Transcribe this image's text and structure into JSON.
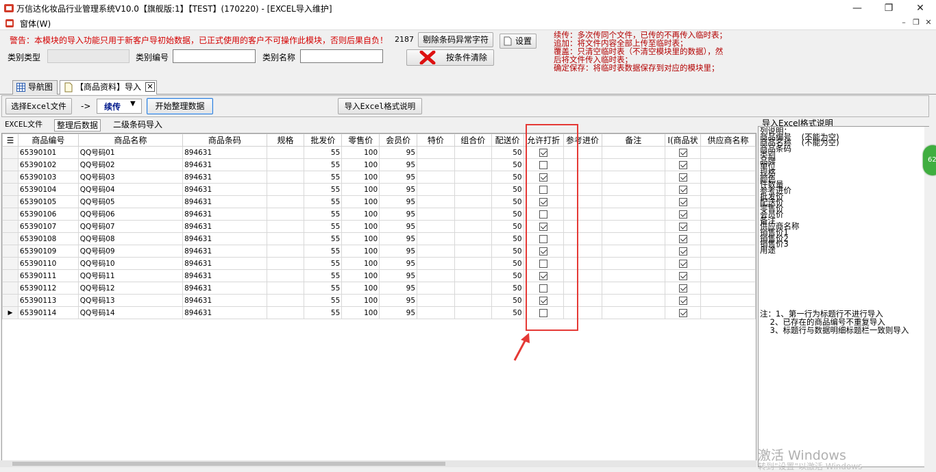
{
  "window": {
    "title": "万信达化妆品行业管理系统V10.0【旗舰版:1】【TEST】(170220) - [EXCEL导入维护]",
    "minimize": "—",
    "restore": "❐",
    "close": "✕"
  },
  "menubar": {
    "window_menu": "窗体(W)",
    "mdi_min": "–",
    "mdi_restore": "❐",
    "mdi_close": "✕"
  },
  "header": {
    "warning": "警告：本模块的导入功能只用于新客户导初始数据，已正式使用的客户不可操作此模块，否则后果自负！",
    "count": "2187",
    "remove_button": "剔除条码异常字符",
    "clear_button": "按条件清除",
    "settings_button": "设置",
    "category_type_label": "类别类型",
    "category_type_value": "",
    "category_code_label": "类别编号",
    "category_code_value": "",
    "category_name_label": "类别名称",
    "category_name_value": "",
    "notes": [
      "续传：多次传同个文件，已传的不再传入临时表；",
      "追加：将文件内容全部上传至临时表；",
      "覆盖：只清空临时表（不清空模块里的数据），然",
      "后将文件传入临时表；",
      "确定保存：将临时表数据保存到对应的模块里；"
    ]
  },
  "tabs": {
    "nav": "导航图",
    "import": "【商品资料】导入"
  },
  "toolbar": {
    "select_excel": "选择Excel文件",
    "arrow": "->",
    "mode": "续传",
    "start": "开始整理数据",
    "format_help": "导入Excel格式说明"
  },
  "subtabs": {
    "excel": "EXCEL文件",
    "sorted": "整理后数据",
    "barcode": "二级条码导入"
  },
  "grid": {
    "columns": [
      "商品编号",
      "商品名称",
      "商品条码",
      "规格",
      "批发价",
      "零售价",
      "会员价",
      "特价",
      "组合价",
      "配送价",
      "允许打折",
      "参考进价",
      "备注",
      "I(商品状",
      "供应商名称"
    ],
    "rows": [
      {
        "code": "65390101",
        "name": "QQ号码01",
        "barcode": "894631",
        "spec": "",
        "wholesale": "55",
        "retail": "100",
        "member": "95",
        "special": "",
        "combo": "",
        "delivery": "50",
        "discount": true,
        "ref": "",
        "remark": "",
        "status": true,
        "supplier": "",
        "current": false
      },
      {
        "code": "65390102",
        "name": "QQ号码02",
        "barcode": "894631",
        "spec": "",
        "wholesale": "55",
        "retail": "100",
        "member": "95",
        "special": "",
        "combo": "",
        "delivery": "50",
        "discount": false,
        "ref": "",
        "remark": "",
        "status": true,
        "supplier": "",
        "current": false
      },
      {
        "code": "65390103",
        "name": "QQ号码03",
        "barcode": "894631",
        "spec": "",
        "wholesale": "55",
        "retail": "100",
        "member": "95",
        "special": "",
        "combo": "",
        "delivery": "50",
        "discount": true,
        "ref": "",
        "remark": "",
        "status": true,
        "supplier": "",
        "current": false
      },
      {
        "code": "65390104",
        "name": "QQ号码04",
        "barcode": "894631",
        "spec": "",
        "wholesale": "55",
        "retail": "100",
        "member": "95",
        "special": "",
        "combo": "",
        "delivery": "50",
        "discount": false,
        "ref": "",
        "remark": "",
        "status": true,
        "supplier": "",
        "current": false
      },
      {
        "code": "65390105",
        "name": "QQ号码05",
        "barcode": "894631",
        "spec": "",
        "wholesale": "55",
        "retail": "100",
        "member": "95",
        "special": "",
        "combo": "",
        "delivery": "50",
        "discount": true,
        "ref": "",
        "remark": "",
        "status": true,
        "supplier": "",
        "current": false
      },
      {
        "code": "65390106",
        "name": "QQ号码06",
        "barcode": "894631",
        "spec": "",
        "wholesale": "55",
        "retail": "100",
        "member": "95",
        "special": "",
        "combo": "",
        "delivery": "50",
        "discount": false,
        "ref": "",
        "remark": "",
        "status": true,
        "supplier": "",
        "current": false
      },
      {
        "code": "65390107",
        "name": "QQ号码07",
        "barcode": "894631",
        "spec": "",
        "wholesale": "55",
        "retail": "100",
        "member": "95",
        "special": "",
        "combo": "",
        "delivery": "50",
        "discount": true,
        "ref": "",
        "remark": "",
        "status": true,
        "supplier": "",
        "current": false
      },
      {
        "code": "65390108",
        "name": "QQ号码08",
        "barcode": "894631",
        "spec": "",
        "wholesale": "55",
        "retail": "100",
        "member": "95",
        "special": "",
        "combo": "",
        "delivery": "50",
        "discount": false,
        "ref": "",
        "remark": "",
        "status": true,
        "supplier": "",
        "current": false
      },
      {
        "code": "65390109",
        "name": "QQ号码09",
        "barcode": "894631",
        "spec": "",
        "wholesale": "55",
        "retail": "100",
        "member": "95",
        "special": "",
        "combo": "",
        "delivery": "50",
        "discount": true,
        "ref": "",
        "remark": "",
        "status": true,
        "supplier": "",
        "current": false
      },
      {
        "code": "65390110",
        "name": "QQ号码10",
        "barcode": "894631",
        "spec": "",
        "wholesale": "55",
        "retail": "100",
        "member": "95",
        "special": "",
        "combo": "",
        "delivery": "50",
        "discount": false,
        "ref": "",
        "remark": "",
        "status": true,
        "supplier": "",
        "current": false
      },
      {
        "code": "65390111",
        "name": "QQ号码11",
        "barcode": "894631",
        "spec": "",
        "wholesale": "55",
        "retail": "100",
        "member": "95",
        "special": "",
        "combo": "",
        "delivery": "50",
        "discount": true,
        "ref": "",
        "remark": "",
        "status": true,
        "supplier": "",
        "current": false
      },
      {
        "code": "65390112",
        "name": "QQ号码12",
        "barcode": "894631",
        "spec": "",
        "wholesale": "55",
        "retail": "100",
        "member": "95",
        "special": "",
        "combo": "",
        "delivery": "50",
        "discount": false,
        "ref": "",
        "remark": "",
        "status": true,
        "supplier": "",
        "current": false
      },
      {
        "code": "65390113",
        "name": "QQ号码13",
        "barcode": "894631",
        "spec": "",
        "wholesale": "55",
        "retail": "100",
        "member": "95",
        "special": "",
        "combo": "",
        "delivery": "50",
        "discount": true,
        "ref": "",
        "remark": "",
        "status": true,
        "supplier": "",
        "current": false
      },
      {
        "code": "65390114",
        "name": "QQ号码14",
        "barcode": "894631",
        "spec": "",
        "wholesale": "55",
        "retail": "100",
        "member": "95",
        "special": "",
        "combo": "",
        "delivery": "50",
        "discount": false,
        "ref": "",
        "remark": "",
        "status": true,
        "supplier": "",
        "current": true
      }
    ]
  },
  "right_panel": {
    "title": "导入Excel格式说明",
    "lines": [
      "列说明：",
      "商品编号    (不能为空)",
      "商品名称    (不能为空)",
      "商品条码",
      "类别",
      "品牌",
      "单位",
      "规格",
      "颜色",
      "件数量",
      "参考进价",
      "批发价",
      "配送价",
      "零售价",
      "会员价",
      "备注",
      "供应商名称",
      "销售价1",
      "销售价2",
      "销售价3",
      "用途"
    ],
    "notes": [
      "注：1、第一行为标题行不进行导入",
      "    2、已存在的商品编号不重复导入",
      "    3、标题行与数据明细标题栏一致则导入"
    ]
  },
  "badge": "62",
  "watermark": "激活 Windows",
  "watermark_sub": "转到\"设置\"以激活 Windows",
  "colors": {
    "warning": "#d40000",
    "notes": "#b30000",
    "highlight": "#e53935",
    "badge": "#3fae3f"
  }
}
